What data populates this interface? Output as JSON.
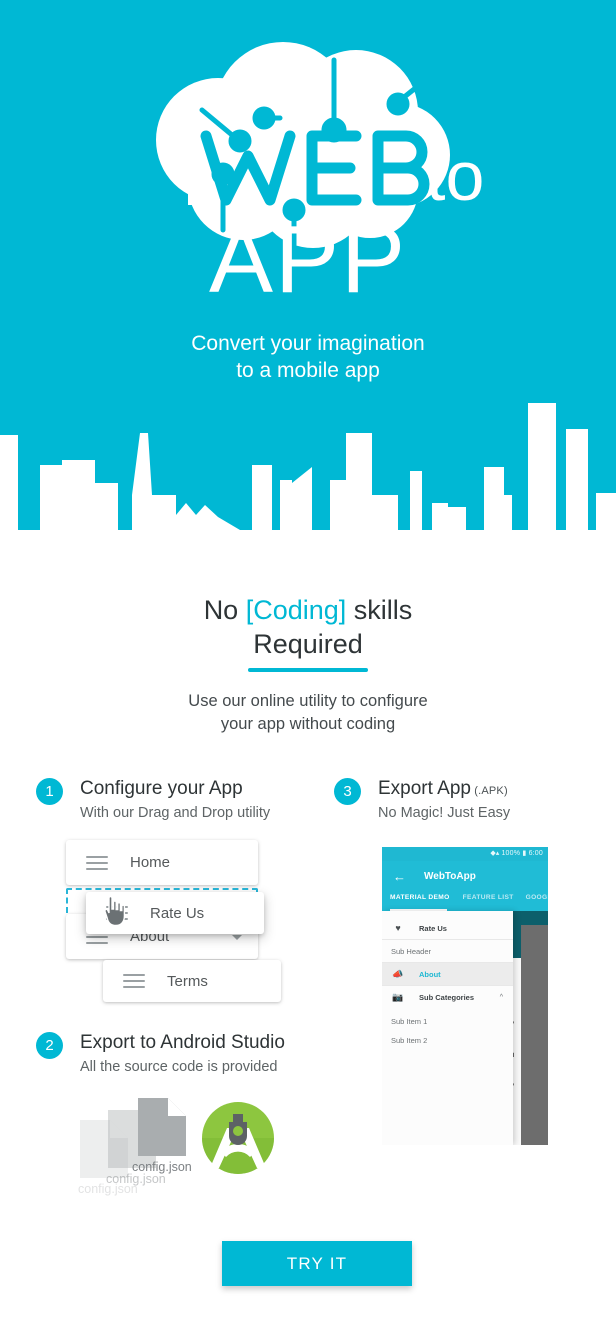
{
  "colors": {
    "brand_cyan": "#00b8d4",
    "phone_cyan": "#20bcd6",
    "headline_dark": "#2e3436",
    "android_green": "#8dc63f",
    "scrim_teal": "#0c5f6b",
    "scrim_gray": "#6d6d6d"
  },
  "hero": {
    "logo_text_web": "WEB",
    "logo_text_to": "to",
    "logo_text_app": "APP",
    "tagline_line1": "Convert your imagination",
    "tagline_line2": "to a mobile app"
  },
  "headline": {
    "part1": "No ",
    "accent": "[Coding]",
    "part2": " skills",
    "line2": "Required",
    "sub_line1": "Use our online utility to configure",
    "sub_line2": "your app without coding"
  },
  "steps": [
    {
      "number": "1",
      "title": "Configure your App",
      "title_suffix": "",
      "desc": "With our Drag and Drop utility"
    },
    {
      "number": "2",
      "title": "Export to Android Studio",
      "title_suffix": "",
      "desc": "All the source code is provided"
    },
    {
      "number": "3",
      "title": "Export App",
      "title_suffix": " (.APK)",
      "desc": "No Magic! Just Easy"
    }
  ],
  "drag_drop": {
    "items": [
      {
        "label": "Home"
      },
      {
        "label": "About"
      },
      {
        "label": "Terms"
      }
    ],
    "dragged_item": "Rate Us"
  },
  "phone": {
    "status_signal": "100%",
    "status_time": "6:00",
    "app_title": "WebToApp",
    "back_glyph": "←",
    "tabs": [
      {
        "label": "MATERIAL DEMO",
        "active": true
      },
      {
        "label": "FEATURE LIST",
        "active": false
      },
      {
        "label": "GOOGLE",
        "active": false
      }
    ],
    "drawer": [
      {
        "icon": "heart-icon",
        "glyph": "♥",
        "label": "Rate Us",
        "type": "item",
        "selected": false
      },
      {
        "icon": "",
        "glyph": "",
        "label": "Sub Header",
        "type": "subheader",
        "selected": false
      },
      {
        "icon": "megaphone-icon",
        "glyph": "📣",
        "label": "About",
        "type": "item",
        "selected": true
      },
      {
        "icon": "camera-icon",
        "glyph": "📷",
        "label": "Sub Categories",
        "type": "expandable",
        "selected": false
      }
    ],
    "sub_items": [
      "Sub Item 1",
      "Sub Item 2"
    ],
    "scrim_letters": [
      "y",
      "h",
      "y"
    ]
  },
  "files": {
    "labels": [
      "config.json",
      "config.json",
      "config.json"
    ]
  },
  "cta": {
    "label": "TRY IT"
  }
}
